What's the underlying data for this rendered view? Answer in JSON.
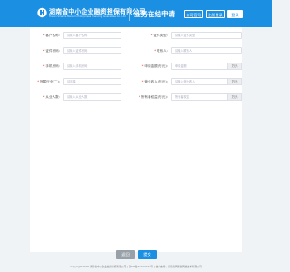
{
  "header": {
    "org_name": "湖南省中小企业融资担保有限公司",
    "org_name_en": "Hunan Small & Medium Enterprises Financing Guarantee Co., Ltd",
    "page_title": "业务在线申请",
    "buttons": [
      "公司官网",
      "注册登录",
      "登录"
    ],
    "bg_color": "#1b8fe1"
  },
  "form": {
    "fields": [
      {
        "label": "客户名称",
        "required": true,
        "placeholder": "请输入客户名称"
      },
      {
        "label": "证件类型",
        "required": true,
        "placeholder": "请输入证件类型"
      },
      {
        "label": "证件号码",
        "required": true,
        "placeholder": "请输入证件号码"
      },
      {
        "label": "联系人",
        "required": true,
        "placeholder": "请输入联系人"
      },
      {
        "label": "手机号码",
        "required": true,
        "placeholder": "请输入手机号码"
      },
      {
        "label": "申请金额(万元)",
        "required": true,
        "placeholder": "申请金额",
        "unit": "万元"
      },
      {
        "label": "所属行业(二)",
        "required": true,
        "placeholder": "请选择"
      },
      {
        "label": "营业收入(万元)",
        "required": true,
        "placeholder": "请输入营业收入",
        "unit": "万元"
      },
      {
        "label": "从业人数",
        "required": true,
        "placeholder": "请输入从业人数"
      },
      {
        "label": "所有者权益(万元)",
        "required": true,
        "placeholder": "所有者权益",
        "unit": "万元"
      }
    ]
  },
  "actions": {
    "reset_label": "返回",
    "submit_label": "提交"
  },
  "footer": {
    "text": "Copyright 2020 湖南省中小企业融资担保有限公司 | 湘ICP备XXXXXXXX号 | 技术支持：湖南竞网智赢网络技术有限公司"
  }
}
